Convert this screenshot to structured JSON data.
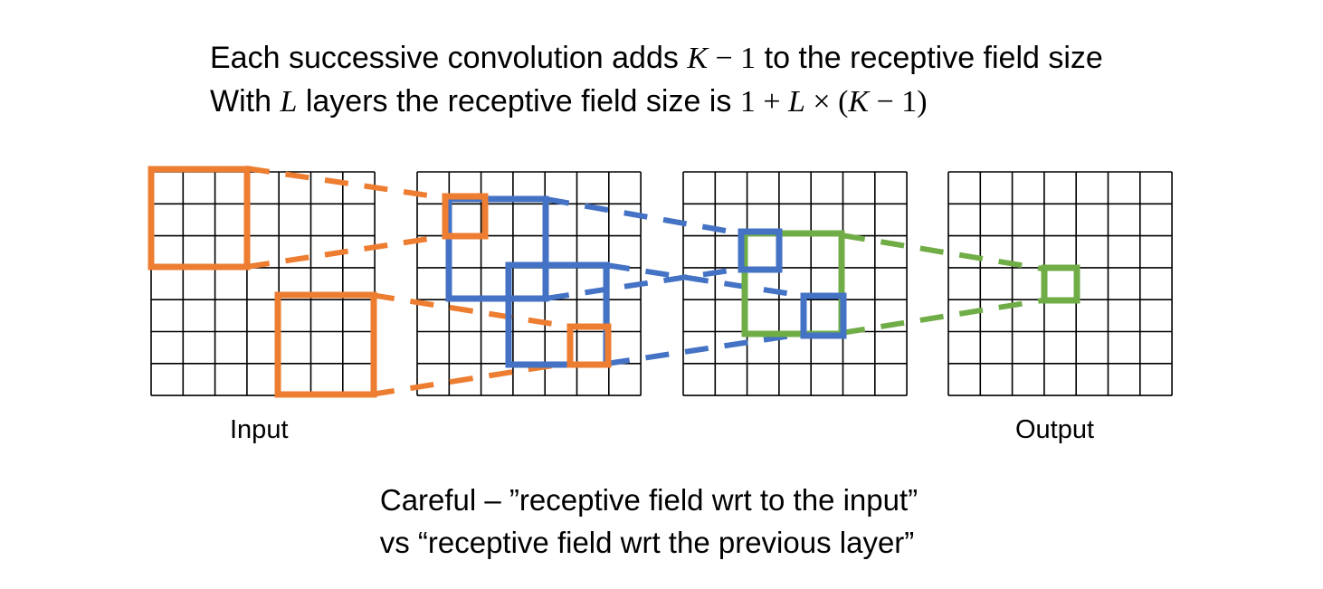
{
  "header": {
    "line1_pre": "Each successive convolution adds ",
    "line1_K": "K",
    "line1_math": " − 1",
    "line1_post": " to the receptive field size",
    "line2_pre": "With ",
    "line2_L": "L",
    "line2_post": " layers the receptive field size is ",
    "line2_m1": "1 + ",
    "line2_L2": "L",
    "line2_m2": " × (",
    "line2_K": "K",
    "line2_m3": " − 1)"
  },
  "labels": {
    "input": "Input",
    "output": "Output"
  },
  "caption": {
    "line1": "Careful – ”receptive field wrt to the input”",
    "line2": "vs “receptive field wrt the previous layer”"
  },
  "colors": {
    "grid": "#000000",
    "orange": "#ED7D31",
    "blue": "#4472C4",
    "green": "#70AD47"
  },
  "diagram": {
    "grid_size": 7,
    "layers": 4,
    "kernel_size": 3
  }
}
